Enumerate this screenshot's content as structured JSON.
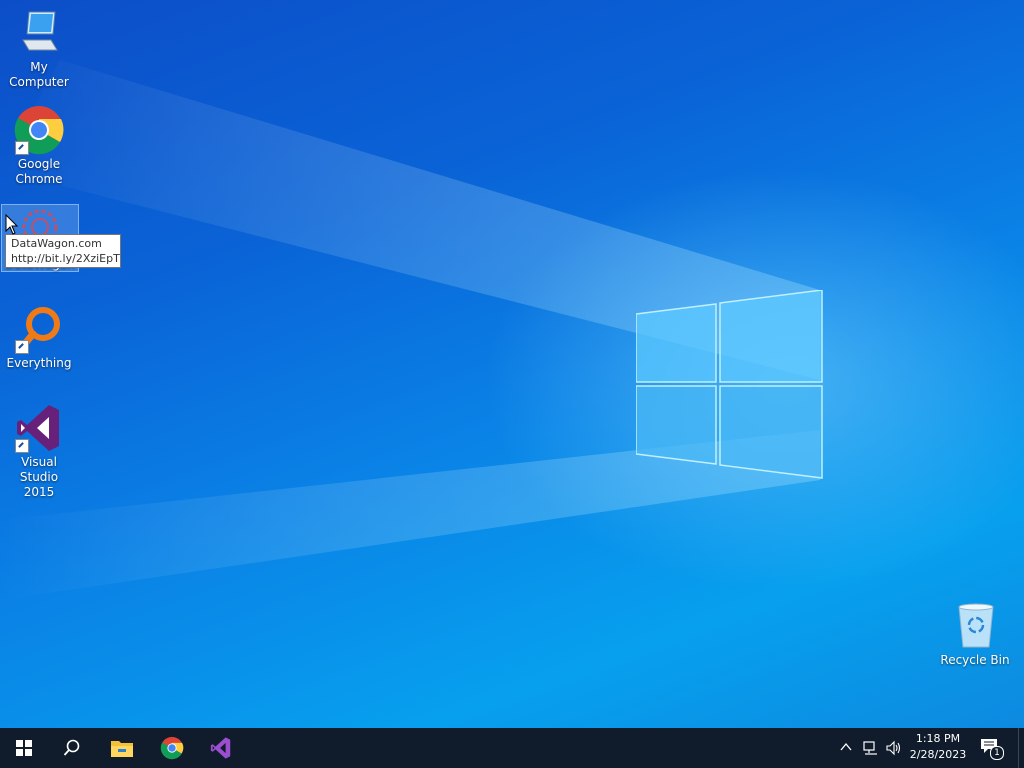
{
  "desktop": {
    "icons": [
      {
        "label": "My Computer",
        "icon": "computer-icon"
      },
      {
        "label": "Google\nChrome",
        "icon": "chrome-icon"
      },
      {
        "label": "DataWagon",
        "icon": "datawagon-icon"
      },
      {
        "label": "Everything",
        "icon": "everything-icon"
      },
      {
        "label": "Visual Studio\n2015",
        "icon": "visual-studio-icon"
      },
      {
        "label": "Recycle Bin",
        "icon": "recycle-bin-icon"
      }
    ],
    "tooltip": {
      "line1": "DataWagon.com",
      "line2": "http://bit.ly/2XziEpT"
    }
  },
  "taskbar": {
    "pinned": [
      "start-icon",
      "search-icon",
      "file-explorer-icon",
      "chrome-icon",
      "visual-studio-icon"
    ],
    "clock": {
      "time": "1:18 PM",
      "date": "2/28/2023"
    },
    "notifications_count": "1"
  },
  "colors": {
    "taskbar": "#101b2b",
    "desktop_accent": "#0a82e6"
  }
}
